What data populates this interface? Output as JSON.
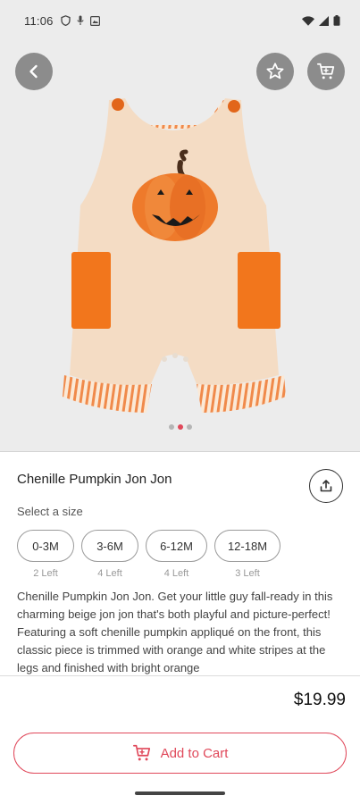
{
  "status": {
    "time": "11:06"
  },
  "product": {
    "title": "Chenille Pumpkin Jon Jon",
    "price": "$19.99",
    "image_count": 3,
    "active_image": 2,
    "description": "Chenille Pumpkin Jon Jon. Get your little guy fall-ready in this charming beige jon jon that's both playful and picture-perfect! Featuring a soft chenille pumpkin appliqué on the front, this classic piece is trimmed with orange and white stripes at the legs and finished with bright orange"
  },
  "sizes": {
    "label": "Select a size",
    "options": [
      {
        "label": "0-3M",
        "stock": "2 Left"
      },
      {
        "label": "3-6M",
        "stock": "4 Left"
      },
      {
        "label": "6-12M",
        "stock": "4 Left"
      },
      {
        "label": "12-18M",
        "stock": "3 Left"
      }
    ]
  },
  "actions": {
    "add_to_cart": "Add to Cart"
  },
  "colors": {
    "accent": "#e0485a",
    "hero_bg": "#ececec",
    "overlay_button": "#8c8c8c"
  },
  "icons": [
    "back-arrow-icon",
    "star-icon",
    "cart-icon",
    "share-icon"
  ]
}
